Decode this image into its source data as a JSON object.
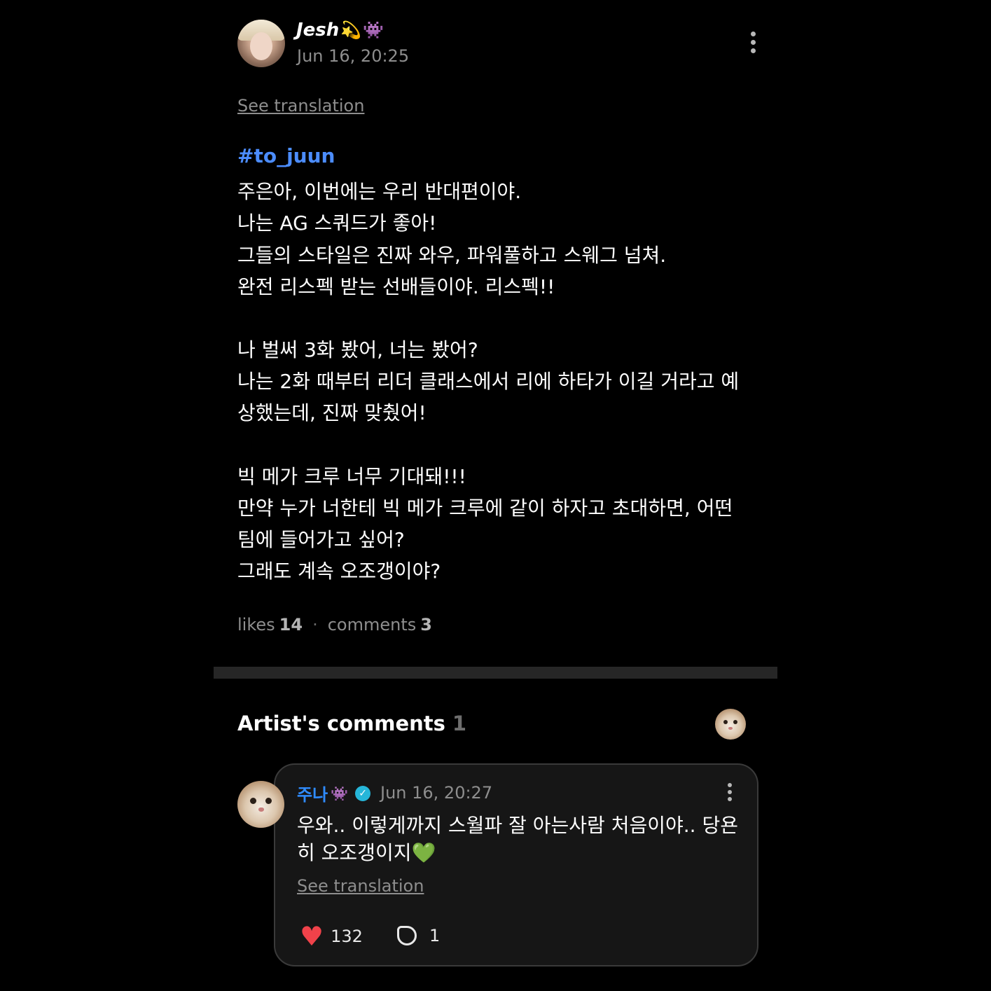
{
  "post": {
    "author_name": "Jesh",
    "author_emojis": [
      "💫",
      "👾"
    ],
    "time": "Jun 16, 20:25",
    "see_translation": "See translation",
    "hashtag": "#to_juun",
    "lines": [
      "주은아, 이번에는 우리 반대편이야.",
      "나는 AG 스쿼드가 좋아!",
      "그들의 스타일은 진짜 와우, 파워풀하고 스웨그 넘쳐.",
      "완전 리스펙 받는 선배들이야. 리스펙!!",
      "나 벌써 3화 봤어, 너는 봤어?",
      "나는 2화 때부터 리더 클래스에서 리에 하타가 이길 거라고 예",
      "상했는데, 진짜 맞췄어!",
      "빅 메가 크루 너무 기대돼!!!",
      "만약 누가 너한테 빅 메가 크루에 같이 하자고 초대하면, 어떤",
      "팀에 들어가고 싶어?",
      "그래도 계속 오조갱이야?"
    ],
    "likes_label": "likes",
    "likes_count": "14",
    "separator": "·",
    "comments_label": "comments",
    "comments_count": "3"
  },
  "artist_comments": {
    "title": "Artist's comments",
    "count": "1",
    "comment": {
      "author_name": "주나",
      "author_emoji": "👾",
      "verified_icon": "✓",
      "time": "Jun 16, 20:27",
      "lines": [
        "우와.. 이렇게까지 스월파 잘 아는사람 처음이야.. 당욘",
        "히 오조갱이지💚"
      ],
      "see_translation": "See translation",
      "likes": "132",
      "replies": "1"
    }
  },
  "colors": {
    "background": "#000000",
    "hashtag": "#4c8dff",
    "comment_author": "#2f8cff",
    "heart": "#f0424a",
    "divider": "#262626"
  },
  "icons": [
    "avatar",
    "more-vertical-icon",
    "verified-badge-icon",
    "heart-icon",
    "comment-bubble-icon"
  ]
}
